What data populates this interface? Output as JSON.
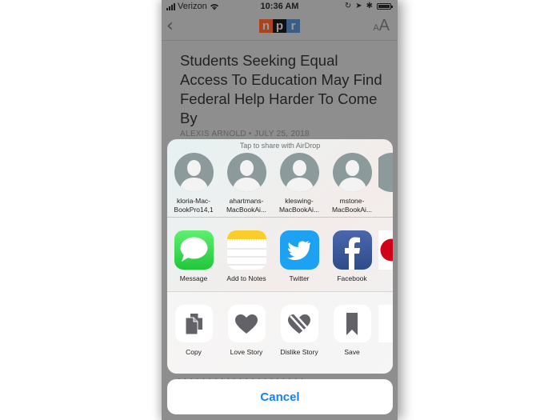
{
  "status_bar": {
    "carrier": "Verizon",
    "time": "10:36 AM",
    "icons": [
      "signal-icon",
      "wifi-icon",
      "orientation-lock-icon",
      "location-icon",
      "bluetooth-icon",
      "battery-icon"
    ]
  },
  "nav": {
    "back_icon": "chevron-left-icon",
    "logo_letters": [
      "n",
      "p",
      "r"
    ],
    "text_size_small": "A",
    "text_size_big": "A"
  },
  "article": {
    "headline": "Students Seeking Equal Access To Education May Find Federal Help Harder To Come By",
    "byline": "ALEXIS ARNOLD • JULY 25, 2018"
  },
  "share_sheet": {
    "airdrop_label": "Tap to share with AirDrop",
    "airdrop_targets": [
      {
        "label": "kloria-Mac-\nBookPro14,1"
      },
      {
        "label": "ahartmans-\nMacBookAi..."
      },
      {
        "label": "kleswing-\nMacBookAi..."
      },
      {
        "label": "mstone-\nMacBookAi..."
      }
    ],
    "apps": [
      {
        "label": "Message",
        "icon": "messages-icon",
        "color": "#34c759"
      },
      {
        "label": "Add to Notes",
        "icon": "notes-icon",
        "color": "#ffd60a"
      },
      {
        "label": "Twitter",
        "icon": "twitter-icon",
        "color": "#1da1f2"
      },
      {
        "label": "Facebook",
        "icon": "facebook-icon",
        "color": "#3b5998"
      }
    ],
    "actions": [
      {
        "label": "Copy",
        "icon": "copy-icon"
      },
      {
        "label": "Love Story",
        "icon": "heart-icon"
      },
      {
        "label": "Dislike Story",
        "icon": "broken-heart-icon"
      },
      {
        "label": "Save",
        "icon": "bookmark-icon"
      }
    ]
  },
  "cancel_label": "Cancel",
  "colors": {
    "accent": "#1a7ff5",
    "action_glyph": "#626268"
  }
}
